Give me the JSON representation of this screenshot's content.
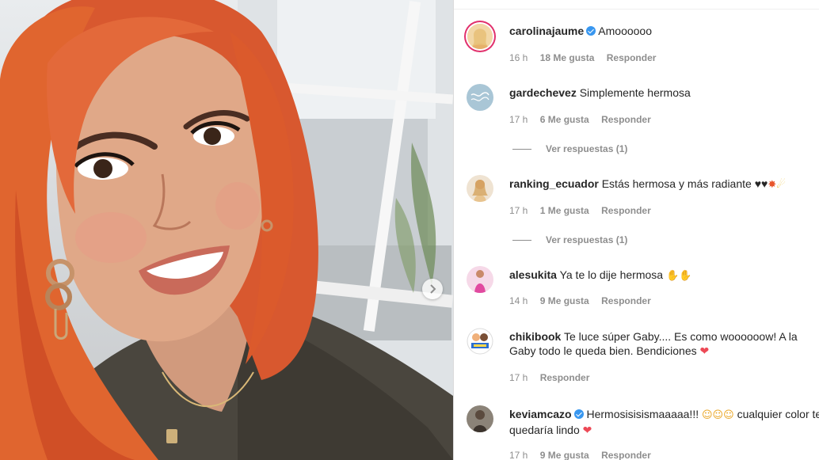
{
  "post": {
    "next_icon": "chevron-right-icon"
  },
  "comments": [
    {
      "username": "carolinajaume",
      "verified": true,
      "text": "Amoooooo",
      "time": "16 h",
      "likes": "18 Me gusta",
      "reply": "Responder",
      "avatar_color": "#e8b15a"
    },
    {
      "username": "gardechevez",
      "verified": false,
      "text": "Simplemente hermosa",
      "time": "17 h",
      "likes": "6 Me gusta",
      "reply": "Responder",
      "view_replies": "Ver respuestas (1)",
      "avatar_color": "#a9c6d6"
    },
    {
      "username": "ranking_ecuador",
      "verified": false,
      "text": "Estás hermosa y más radiante ♥♥",
      "time": "17 h",
      "likes": "1 Me gusta",
      "reply": "Responder",
      "view_replies": "Ver respuestas (1)",
      "avatar_color": "#d9b98e"
    },
    {
      "username": "alesukita",
      "verified": false,
      "text": "Ya te lo dije hermosa",
      "time": "14 h",
      "likes": "9 Me gusta",
      "reply": "Responder",
      "avatar_color": "#e14aa0"
    },
    {
      "username": "chikibook",
      "verified": false,
      "text": "Te luce súper Gaby.... Es como woooooow! A la Gaby todo le queda bien. Bendiciones",
      "time": "17 h",
      "reply": "Responder",
      "avatar_color": "#ffffff"
    },
    {
      "username": "keviamcazo",
      "verified": true,
      "text": "Hermosisisismaaaaa!!!",
      "text_2": "cualquier color te quedaría lindo",
      "time": "17 h",
      "likes": "9 Me gusta",
      "reply": "Responder",
      "avatar_color": "#6b6158"
    }
  ]
}
